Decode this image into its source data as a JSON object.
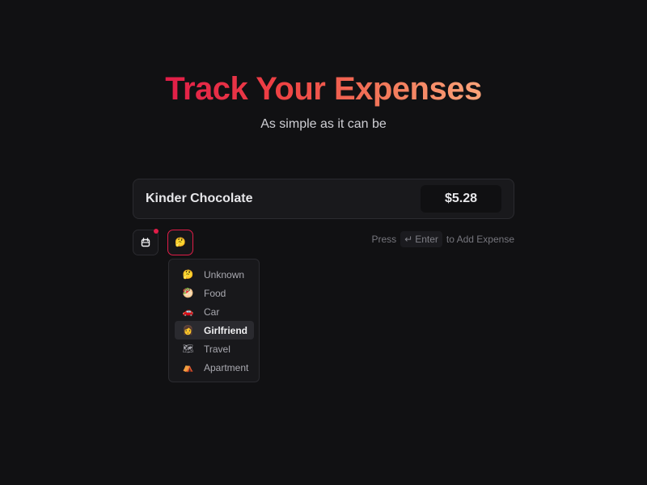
{
  "hero": {
    "title": "Track Your Expenses",
    "subtitle": "As simple as it can be"
  },
  "expense": {
    "name": "Kinder Chocolate",
    "amount": "$5.28"
  },
  "controls": {
    "calendar_icon": "calendar-icon",
    "selected_category_icon": "🤔",
    "notification_dot_color": "#e11d48"
  },
  "hint": {
    "prefix": "Press",
    "key_symbol": "↵",
    "key_label": "Enter",
    "suffix": "to Add Expense"
  },
  "categories": [
    {
      "icon": "🤔",
      "label": "Unknown",
      "selected": false
    },
    {
      "icon": "🥙",
      "label": "Food",
      "selected": false
    },
    {
      "icon": "🚗",
      "label": "Car",
      "selected": false
    },
    {
      "icon": "👩",
      "label": "Girlfriend",
      "selected": true
    },
    {
      "icon": "🗺",
      "label": "Travel",
      "selected": false
    },
    {
      "icon": "⛺",
      "label": "Apartment",
      "selected": false
    }
  ],
  "colors": {
    "background": "#111113",
    "accent": "#e11d48",
    "title_gradient_start": "#e11d48",
    "title_gradient_end": "#fda47a"
  }
}
